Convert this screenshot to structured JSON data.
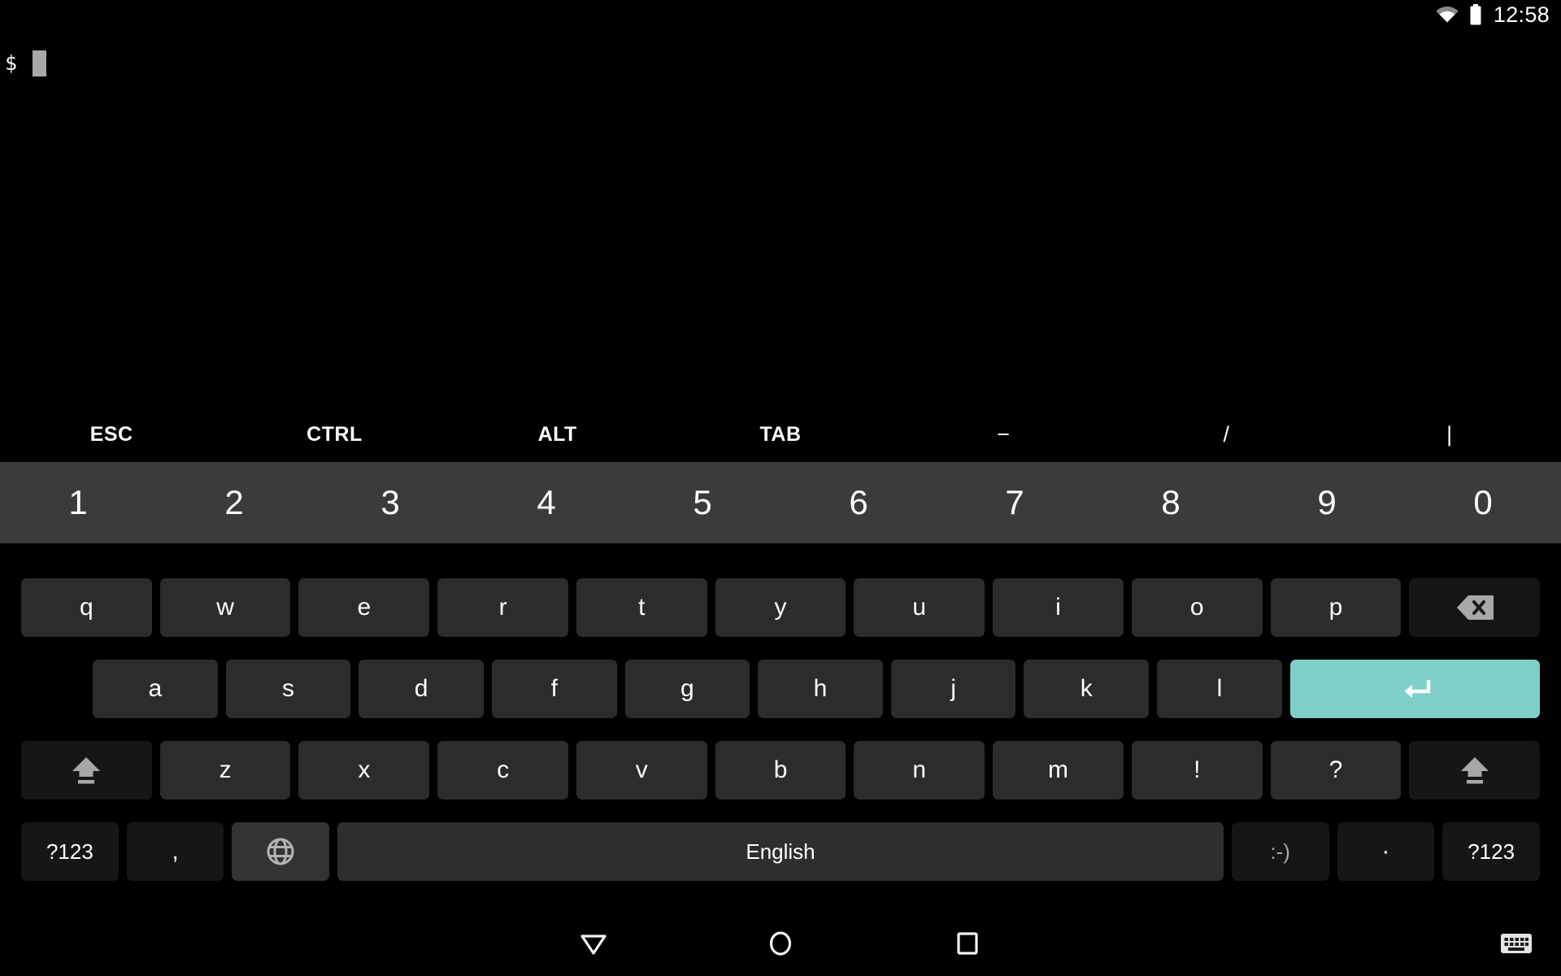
{
  "status_bar": {
    "wifi_icon": "wifi-icon",
    "battery_icon": "battery-icon",
    "clock": "12:58"
  },
  "terminal": {
    "prompt": "$",
    "cursor_icon": "block-cursor",
    "background_color": "#000000",
    "text_color": "#ffffff"
  },
  "extra_key_row": {
    "keys": [
      {
        "label": "ESC",
        "name": "key-esc",
        "style": "word"
      },
      {
        "label": "CTRL",
        "name": "key-ctrl",
        "style": "word"
      },
      {
        "label": "ALT",
        "name": "key-alt",
        "style": "word"
      },
      {
        "label": "TAB",
        "name": "key-tab",
        "style": "word"
      },
      {
        "label": "−",
        "name": "key-minus",
        "style": "sym"
      },
      {
        "label": "/",
        "name": "key-slash",
        "style": "sym"
      },
      {
        "label": "|",
        "name": "key-pipe",
        "style": "sym"
      }
    ]
  },
  "number_row": {
    "background_color": "#3b3b3b",
    "keys": [
      {
        "label": "1",
        "name": "key-1"
      },
      {
        "label": "2",
        "name": "key-2"
      },
      {
        "label": "3",
        "name": "key-3"
      },
      {
        "label": "4",
        "name": "key-4"
      },
      {
        "label": "5",
        "name": "key-5"
      },
      {
        "label": "6",
        "name": "key-6"
      },
      {
        "label": "7",
        "name": "key-7"
      },
      {
        "label": "8",
        "name": "key-8"
      },
      {
        "label": "9",
        "name": "key-9"
      },
      {
        "label": "0",
        "name": "key-0"
      }
    ]
  },
  "keyboard": {
    "accent_color": "#7fcfc9",
    "key_color": "#2c2c2c",
    "row_q": [
      {
        "label": "q",
        "name": "key-q"
      },
      {
        "label": "w",
        "name": "key-w"
      },
      {
        "label": "e",
        "name": "key-e"
      },
      {
        "label": "r",
        "name": "key-r"
      },
      {
        "label": "t",
        "name": "key-t"
      },
      {
        "label": "y",
        "name": "key-y"
      },
      {
        "label": "u",
        "name": "key-u"
      },
      {
        "label": "i",
        "name": "key-i"
      },
      {
        "label": "o",
        "name": "key-o"
      },
      {
        "label": "p",
        "name": "key-p"
      }
    ],
    "backspace": {
      "icon": "backspace-icon",
      "name": "key-backspace"
    },
    "row_a": [
      {
        "label": "a",
        "name": "key-a"
      },
      {
        "label": "s",
        "name": "key-s"
      },
      {
        "label": "d",
        "name": "key-d"
      },
      {
        "label": "f",
        "name": "key-f"
      },
      {
        "label": "g",
        "name": "key-g"
      },
      {
        "label": "h",
        "name": "key-h"
      },
      {
        "label": "j",
        "name": "key-j"
      },
      {
        "label": "k",
        "name": "key-k"
      },
      {
        "label": "l",
        "name": "key-l"
      }
    ],
    "enter": {
      "icon": "enter-arrow-icon",
      "name": "key-enter"
    },
    "shift_left": {
      "icon": "shift-icon",
      "name": "key-shift-left"
    },
    "row_z": [
      {
        "label": "z",
        "name": "key-z"
      },
      {
        "label": "x",
        "name": "key-x"
      },
      {
        "label": "c",
        "name": "key-c"
      },
      {
        "label": "v",
        "name": "key-v"
      },
      {
        "label": "b",
        "name": "key-b"
      },
      {
        "label": "n",
        "name": "key-n"
      },
      {
        "label": "m",
        "name": "key-m"
      },
      {
        "label": "!",
        "name": "key-exclamation"
      },
      {
        "label": "?",
        "name": "key-question"
      }
    ],
    "shift_right": {
      "icon": "shift-icon",
      "name": "key-shift-right"
    },
    "bottom_row": {
      "symbols_left": {
        "label": "?123",
        "name": "key-symbols-left"
      },
      "comma": {
        "label": ",",
        "name": "key-comma"
      },
      "globe": {
        "icon": "globe-icon",
        "name": "key-language-switch"
      },
      "space": {
        "label": "English",
        "name": "key-space"
      },
      "emoji": {
        "label": ":-)",
        "name": "key-emoji"
      },
      "period": {
        "label": "·",
        "name": "key-period"
      },
      "symbols_right": {
        "label": "?123",
        "name": "key-symbols-right"
      }
    }
  },
  "nav_bar": {
    "back": {
      "icon": "back-triangle-icon",
      "name": "nav-back-button"
    },
    "home": {
      "icon": "home-circle-icon",
      "name": "nav-home-button"
    },
    "recents": {
      "icon": "recents-square-icon",
      "name": "nav-recents-button"
    },
    "keyboard_switch": {
      "icon": "keyboard-icon",
      "name": "nav-keyboard-switch-button"
    }
  }
}
